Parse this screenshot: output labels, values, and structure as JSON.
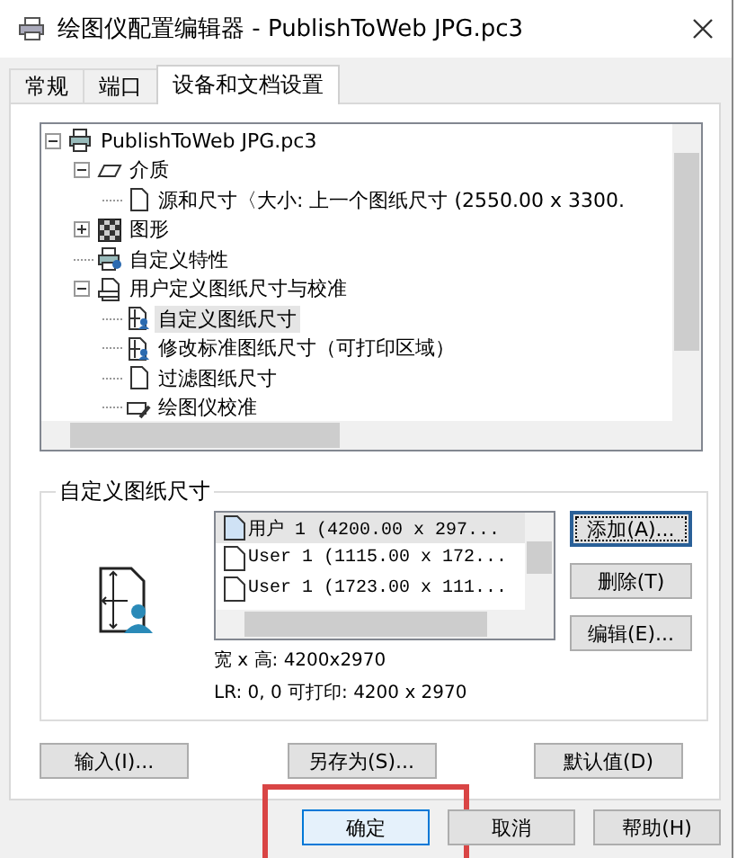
{
  "window": {
    "title": "绘图仪配置编辑器 - PublishToWeb JPG.pc3"
  },
  "tabs": [
    {
      "label": "常规",
      "selected": false
    },
    {
      "label": "端口",
      "selected": false
    },
    {
      "label": "设备和文档设置",
      "selected": true
    }
  ],
  "tree": [
    {
      "label": "PublishToWeb JPG.pc3",
      "kind": "printer",
      "selected": false,
      "expanded": true,
      "children": [
        {
          "label": "介质",
          "kind": "media",
          "selected": false,
          "expanded": true,
          "children": [
            {
              "label": "源和尺寸〈大小: 上一个图纸尺寸  (2550.00 x 3300.",
              "kind": "page",
              "selected": false
            }
          ]
        },
        {
          "label": "图形",
          "kind": "pattern",
          "selected": false,
          "expanded": false
        },
        {
          "label": "自定义特性",
          "kind": "printer-user",
          "selected": false
        },
        {
          "label": "用户定义图纸尺寸与校准",
          "kind": "page-printer",
          "selected": false,
          "expanded": true,
          "children": [
            {
              "label": "自定义图纸尺寸",
              "kind": "paper-size",
              "selected": true
            },
            {
              "label": "修改标准图纸尺寸（可打印区域）",
              "kind": "paper-size",
              "selected": false
            },
            {
              "label": "过滤图纸尺寸",
              "kind": "page",
              "selected": false
            },
            {
              "label": "绘图仪校准",
              "kind": "calibrate",
              "selected": false
            }
          ]
        }
      ]
    }
  ],
  "group": {
    "title": "自定义图纸尺寸",
    "sizes": [
      {
        "label": "用户 1 (4200.00 x 297...",
        "selected": true
      },
      {
        "label": "User 1 (1115.00 x 172...",
        "selected": false
      },
      {
        "label": "User 1 (1723.00 x 111...",
        "selected": false
      }
    ],
    "buttons": [
      {
        "label": "添加(A)...",
        "focused": true
      },
      {
        "label": "删除(T)",
        "focused": false
      },
      {
        "label": "编辑(E)...",
        "focused": false
      }
    ],
    "size_line": "宽 x 高: 4200x2970",
    "print_line": "LR: 0, 0  可打印: 4200 x 2970"
  },
  "panel_buttons": [
    "输入(I)...",
    "另存为(S)...",
    "默认值(D)"
  ],
  "dialog_buttons": [
    {
      "label": "确定",
      "default": true,
      "highlighted": true
    },
    {
      "label": "取消",
      "default": false,
      "highlighted": false
    },
    {
      "label": "帮助(H)",
      "default": false,
      "highlighted": false
    }
  ]
}
